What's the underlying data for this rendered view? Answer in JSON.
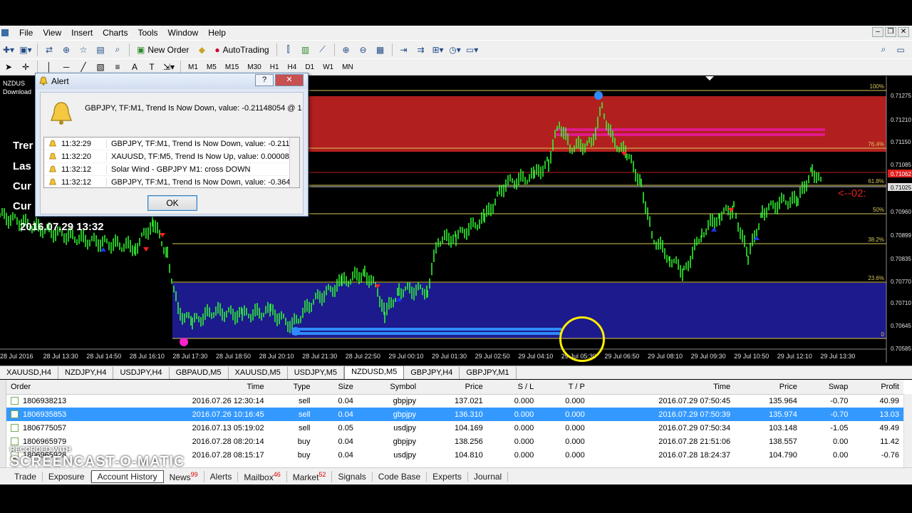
{
  "menu": [
    "File",
    "View",
    "Insert",
    "Charts",
    "Tools",
    "Window",
    "Help"
  ],
  "toolbar": {
    "new_order": "New Order",
    "autotrading": "AutoTrading"
  },
  "timeframes": [
    "M1",
    "M5",
    "M15",
    "M30",
    "H1",
    "H4",
    "D1",
    "W1",
    "MN"
  ],
  "chart": {
    "symbol_label": "NZDUS",
    "download_label": "Download",
    "date_label": "2016.07.29 13:32",
    "left_labels": [
      "Trer",
      "Las",
      "Cur",
      "Cur"
    ],
    "arrow_label": "<--02:",
    "fib_labels": [
      "100%",
      "76.4%",
      "61.8%",
      "50%",
      "38.2%",
      "23.6%",
      "0"
    ],
    "price_labels": [
      "0.71275",
      "0.71210",
      "0.71150",
      "0.71085",
      "0.71062",
      "0.71025",
      "0.70960",
      "0.70899",
      "0.70835",
      "0.70770",
      "0.70710",
      "0.70645",
      "0.70585"
    ],
    "time_labels": [
      "28 Jul 2016",
      "28 Jul 13:30",
      "28 Jul 14:50",
      "28 Jul 16:10",
      "28 Jul 17:30",
      "28 Jul 18:50",
      "28 Jul 20:10",
      "28 Jul 21:30",
      "28 Jul 22:50",
      "29 Jul 00:10",
      "29 Jul 01:30",
      "29 Jul 02:50",
      "29 Jul 04:10",
      "29 Jul 05:30",
      "29 Jul 06:50",
      "29 Jul 08:10",
      "29 Jul 09:30",
      "29 Jul 10:50",
      "29 Jul 12:10",
      "29 Jul 13:30"
    ],
    "colors": {
      "upper_zone": "#b21f1f",
      "lower_zone": "#1c1a8c",
      "candles": "#33ff33",
      "fib_line": "#d8c85a"
    }
  },
  "alert": {
    "title": "Alert",
    "message": "GBPJPY, TF:M1, Trend Is Now Down, value: -0.21148054 @ 1",
    "rows": [
      {
        "time": "11:32:29",
        "text": "GBPJPY, TF:M1, Trend Is Now Down, value: -0.211..."
      },
      {
        "time": "11:32:20",
        "text": "XAUUSD, TF:M5, Trend Is Now Up, value: 0.000088..."
      },
      {
        "time": "11:32:12",
        "text": "Solar Wind - GBPJPY M1: cross DOWN"
      },
      {
        "time": "11:32:12",
        "text": "GBPJPY, TF:M1, Trend Is Now Down, value: -0.364"
      }
    ],
    "ok": "OK"
  },
  "chart_tabs": [
    "XAUUSD,H4",
    "NZDJPY,H4",
    "USDJPY,H4",
    "GBPAUD,M5",
    "XAUUSD,M5",
    "USDJPY,M5",
    "NZDUSD,M5",
    "GBPJPY,H4",
    "GBPJPY,M1"
  ],
  "active_chart_tab": "NZDUSD,M5",
  "orders": {
    "headers": [
      "Order",
      "Time",
      "Type",
      "Size",
      "Symbol",
      "Price",
      "S / L",
      "T / P",
      "Time",
      "Price",
      "Swap",
      "Profit"
    ],
    "rows": [
      [
        "1806938213",
        "2016.07.26 12:30:14",
        "sell",
        "0.04",
        "gbpjpy",
        "137.021",
        "0.000",
        "0.000",
        "2016.07.29 07:50:45",
        "135.964",
        "-0.70",
        "40.99"
      ],
      [
        "1806935853",
        "2016.07.26 10:16:45",
        "sell",
        "0.04",
        "gbpjpy",
        "136.310",
        "0.000",
        "0.000",
        "2016.07.29 07:50:39",
        "135.974",
        "-0.70",
        "13.03"
      ],
      [
        "1806775057",
        "2016.07.13 05:19:02",
        "sell",
        "0.05",
        "usdjpy",
        "104.169",
        "0.000",
        "0.000",
        "2016.07.29 07:50:34",
        "103.148",
        "-1.05",
        "49.49"
      ],
      [
        "1806965979",
        "2016.07.28 08:20:14",
        "buy",
        "0.04",
        "gbpjpy",
        "138.256",
        "0.000",
        "0.000",
        "2016.07.28 21:51:06",
        "138.557",
        "0.00",
        "11.42"
      ],
      [
        "1806965928",
        "2016.07.28 08:15:17",
        "buy",
        "0.04",
        "usdjpy",
        "104.810",
        "0.000",
        "0.000",
        "2016.07.28 18:24:37",
        "104.790",
        "0.00",
        "-0.76"
      ]
    ],
    "selected_row": 1
  },
  "bottom_tabs": [
    {
      "label": "Trade",
      "badge": ""
    },
    {
      "label": "Exposure",
      "badge": ""
    },
    {
      "label": "Account History",
      "badge": ""
    },
    {
      "label": "News",
      "badge": "99"
    },
    {
      "label": "Alerts",
      "badge": ""
    },
    {
      "label": "Mailbox",
      "badge": "46"
    },
    {
      "label": "Market",
      "badge": "52"
    },
    {
      "label": "Signals",
      "badge": ""
    },
    {
      "label": "Code Base",
      "badge": ""
    },
    {
      "label": "Experts",
      "badge": ""
    },
    {
      "label": "Journal",
      "badge": ""
    }
  ],
  "active_bottom_tab": "Account History",
  "watermark": {
    "line1": "RECORDED WITH",
    "line2": "SCREENCAST-O-MATIC"
  }
}
